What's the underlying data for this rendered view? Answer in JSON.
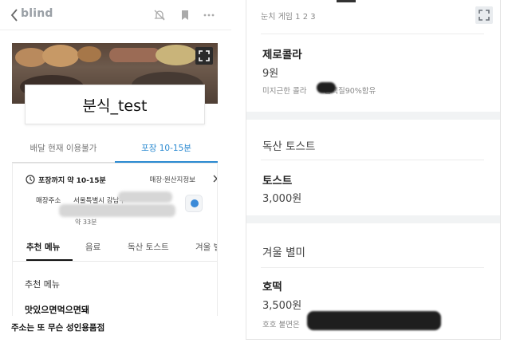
{
  "left": {
    "topbar": {
      "brand": "blind",
      "icons": [
        "back-icon",
        "mute-bell-icon",
        "bookmark-icon",
        "more-icon"
      ]
    },
    "store": {
      "name": "분식_test"
    },
    "mode_tabs": [
      {
        "label": "배달 현재 이용불가",
        "active": false
      },
      {
        "label": "포장 10-15분",
        "active": true
      }
    ],
    "info": {
      "pickup_time": "포장까지 약 10-15분",
      "store_info_link": "매장·원산지정보",
      "address_label": "매장주소",
      "address_value": "서울특별시 강남구",
      "address_extra": "약 33분"
    },
    "category_tabs": [
      {
        "label": "추천 메뉴",
        "active": true
      },
      {
        "label": "음료",
        "active": false
      },
      {
        "label": "독산 토스트",
        "active": false
      },
      {
        "label": "겨울 별",
        "active": false
      }
    ],
    "section_title": "추천 메뉴",
    "first_item": "맛있으면먹으면돼",
    "caption": "주소는 또 무슨 성인용품점"
  },
  "right": {
    "game_text": "눈치 게임 1 2 3",
    "items": [
      {
        "name": "제로콜라",
        "price": "9원",
        "desc_prefix": "미지근한 콜라",
        "desc_suffix": "단백질90%함유"
      }
    ],
    "sections": [
      {
        "title": "독산 토스트",
        "items": [
          {
            "name": "토스트",
            "price": "3,000원"
          }
        ]
      },
      {
        "title": "겨울 별미",
        "items": [
          {
            "name": "호떡",
            "price": "3,500원",
            "desc_prefix": "호호 불면은"
          }
        ]
      }
    ]
  },
  "colors": {
    "accent": "#2b8ad1",
    "brand_gray": "#9aa0a6",
    "section_bg": "#f1f3f4"
  }
}
